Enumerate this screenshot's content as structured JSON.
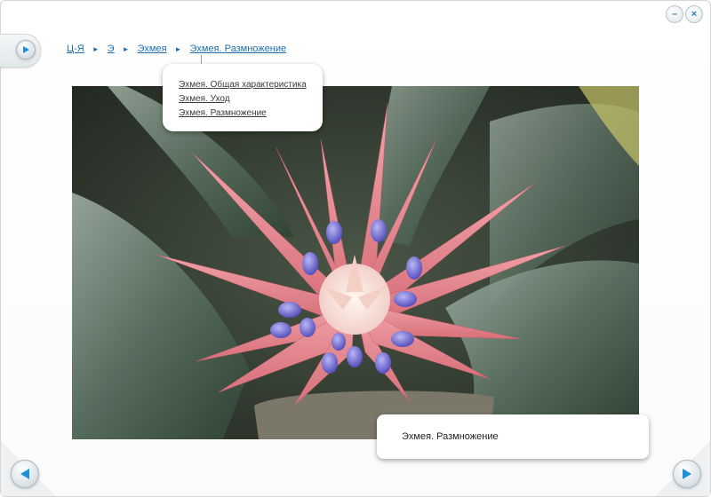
{
  "window": {
    "minimize_icon": "minimize-icon",
    "close_icon": "close-icon"
  },
  "breadcrumb": [
    {
      "label": "Ц-Я"
    },
    {
      "label": "Э"
    },
    {
      "label": "Эхмея"
    },
    {
      "label": "Эхмея. Размножение"
    }
  ],
  "popup": {
    "items": [
      {
        "label": "Эхмея. Общая характеристика"
      },
      {
        "label": "Эхмея. Уход"
      },
      {
        "label": "Эхмея. Размножение"
      }
    ]
  },
  "caption": {
    "text": "Эхмея. Размножение"
  },
  "colors": {
    "accent": "#1b6fb0",
    "arrow_blue": "#1e90d8"
  }
}
